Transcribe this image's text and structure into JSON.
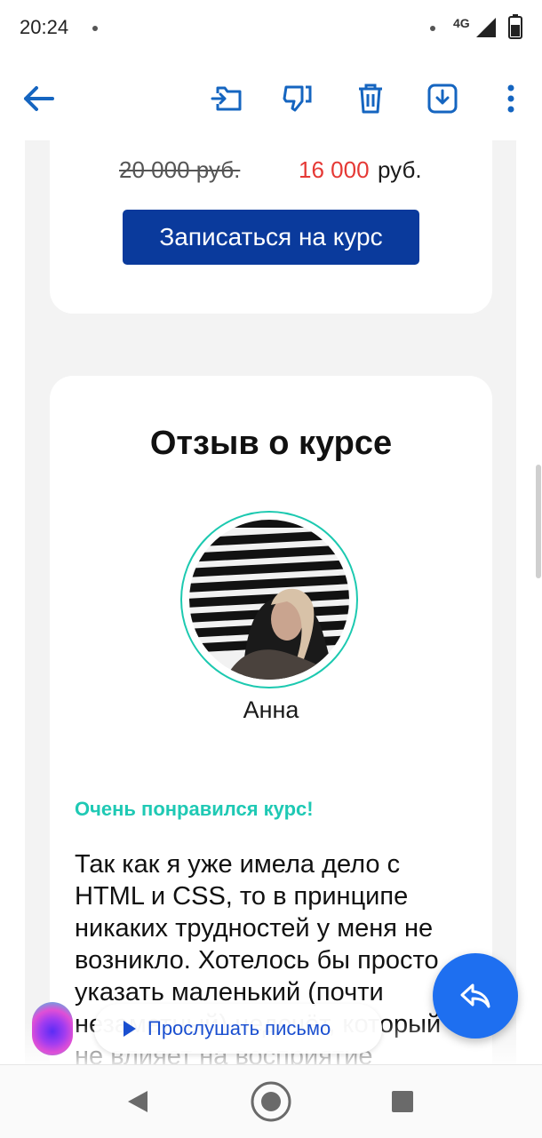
{
  "status_bar": {
    "time": "20:24",
    "network": "4G"
  },
  "toolbar": {
    "icons": [
      "back-arrow-icon",
      "move-to-folder-icon",
      "thumbs-down-icon",
      "delete-icon",
      "download-icon",
      "more-vert-icon"
    ]
  },
  "offer": {
    "old_price": "20 000 руб.",
    "new_price": "16 000",
    "currency": "руб.",
    "enroll_label": "Записаться на курс"
  },
  "review": {
    "title": "Отзыв о курсе",
    "reviewer_name": "Анна",
    "heading": "Очень понравился курс!",
    "text": "Так как я уже имела дело с HTML и CSS, то в принципе никаких трудностей у меня не возникло. Хотелось бы просто указать маленький (почти незаметный) недочёт, который не влияет на восприятие"
  },
  "listen": {
    "label": "Прослушать письмо"
  },
  "colors": {
    "accent_blue": "#0a3a9c",
    "price_red": "#e53935",
    "teal": "#1fc9b4",
    "fab_blue": "#1e6ff0"
  }
}
